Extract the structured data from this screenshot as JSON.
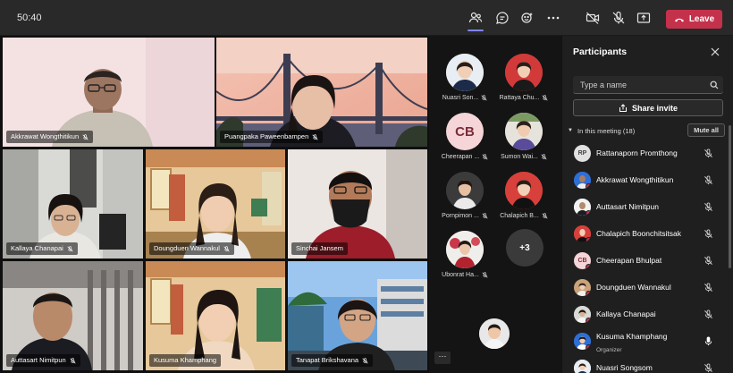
{
  "topbar": {
    "timer": "50:40",
    "leave_label": "Leave"
  },
  "tiles": [
    {
      "name": "Akkrawat Wongthitikun"
    },
    {
      "name": "Puangpaka Paweenbampen"
    },
    {
      "name": "Kallaya Chanapai"
    },
    {
      "name": "Doungduen Wannakul"
    },
    {
      "name": "Sinchai Jansem"
    },
    {
      "name": "Auttasart Nimitpun"
    },
    {
      "name": "Kusuma Khamphang"
    },
    {
      "name": "Tanapat Brikshavana"
    }
  ],
  "gallery": {
    "items": [
      {
        "label": "Nuasri Son..."
      },
      {
        "label": "Rattaya Chu..."
      },
      {
        "label": "Cheerapan ...",
        "initials": "CB"
      },
      {
        "label": "Sumon Wai..."
      },
      {
        "label": "Pornpimon ..."
      },
      {
        "label": "Chalapich B..."
      },
      {
        "label": "Ubonrat Ha..."
      }
    ],
    "more_label": "+3",
    "dots_label": "···"
  },
  "panel": {
    "title": "Participants",
    "search_placeholder": "Type a name",
    "share_label": "Share invite",
    "section_label": "In this meeting (18)",
    "mute_all_label": "Mute all",
    "participants": [
      {
        "name": "Rattanaporn Promthong",
        "initials": "RP",
        "role": ""
      },
      {
        "name": "Akkrawat Wongthitikun",
        "initials": "",
        "role": ""
      },
      {
        "name": "Auttasart Nimitpun",
        "initials": "",
        "role": ""
      },
      {
        "name": "Chalapich Boonchitsitsak",
        "initials": "",
        "role": ""
      },
      {
        "name": "Cheerapan Bhulpat",
        "initials": "CB",
        "role": ""
      },
      {
        "name": "Doungduen Wannakul",
        "initials": "",
        "role": ""
      },
      {
        "name": "Kallaya Chanapai",
        "initials": "",
        "role": ""
      },
      {
        "name": "Kusuma Khamphang",
        "initials": "",
        "role": "Organizer"
      },
      {
        "name": "Nuasri Songsom",
        "initials": "",
        "role": ""
      }
    ]
  },
  "colors": {
    "leave": "#c4314b",
    "accent": "#7f85f5",
    "topbar": "#292929",
    "panel": "#1f1f1f"
  }
}
